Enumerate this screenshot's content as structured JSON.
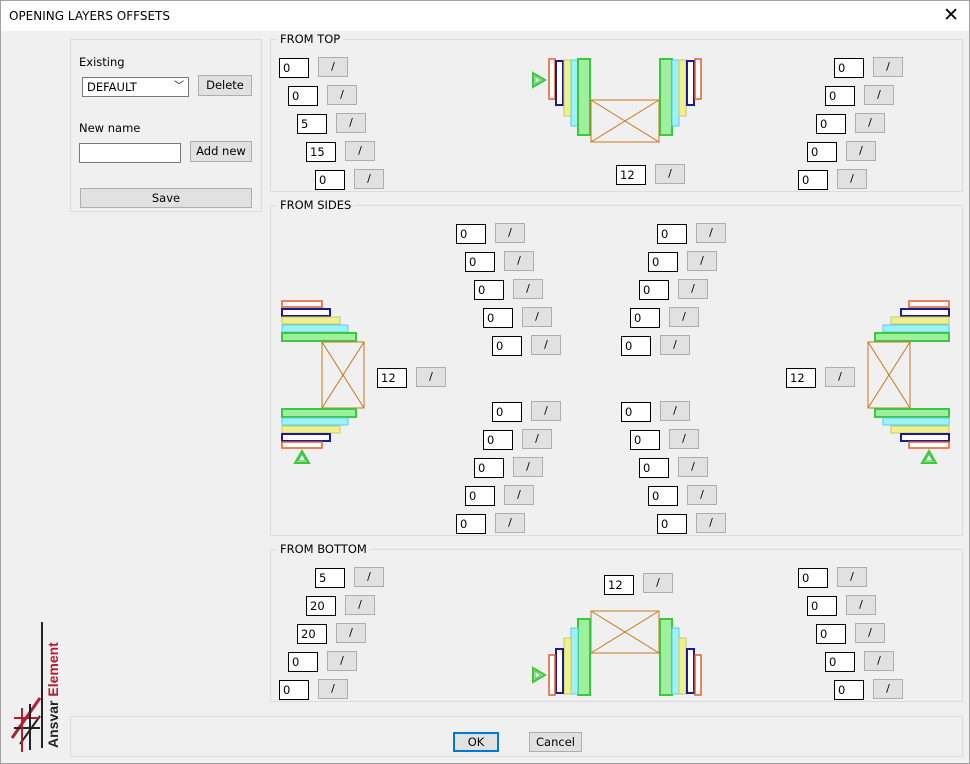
{
  "window": {
    "title": "OPENING LAYERS OFFSETS"
  },
  "left": {
    "existing_label": "Existing",
    "existing_value": "DEFAULT",
    "delete_label": "Delete",
    "new_name_label": "New name",
    "new_name_value": "",
    "add_new_label": "Add new",
    "save_label": "Save"
  },
  "top": {
    "title": "FROM TOP",
    "left": [
      "0",
      "0",
      "5",
      "15",
      "0"
    ],
    "right": [
      "0",
      "0",
      "0",
      "0",
      "0"
    ],
    "center": "12"
  },
  "sides": {
    "title": "FROM SIDES",
    "left_center": "12",
    "right_center": "12",
    "ul": [
      "0",
      "0",
      "0",
      "0",
      "0"
    ],
    "ur": [
      "0",
      "0",
      "0",
      "0",
      "0"
    ],
    "ll": [
      "0",
      "0",
      "0",
      "0",
      "0"
    ],
    "lr": [
      "0",
      "0",
      "0",
      "0",
      "0"
    ]
  },
  "bottom": {
    "title": "FROM BOTTOM",
    "left": [
      "5",
      "20",
      "20",
      "0",
      "0"
    ],
    "right": [
      "0",
      "0",
      "0",
      "0",
      "0"
    ],
    "center": "12"
  },
  "footer": {
    "ok_label": "OK",
    "cancel_label": "Cancel"
  },
  "slash": "/",
  "logo_text": "Ansvar Element",
  "icons": {
    "close": "close-icon",
    "dropdown": "chevron-down-icon"
  },
  "colors": {
    "layer_orange": "#e65a28",
    "layer_blue": "#1a1aa0",
    "layer_yellow": "#f0f08c",
    "layer_cyan": "#50d2e6",
    "layer_green": "#3cc83c",
    "frame": "#c8781e",
    "logo_red": "#b41e32"
  }
}
